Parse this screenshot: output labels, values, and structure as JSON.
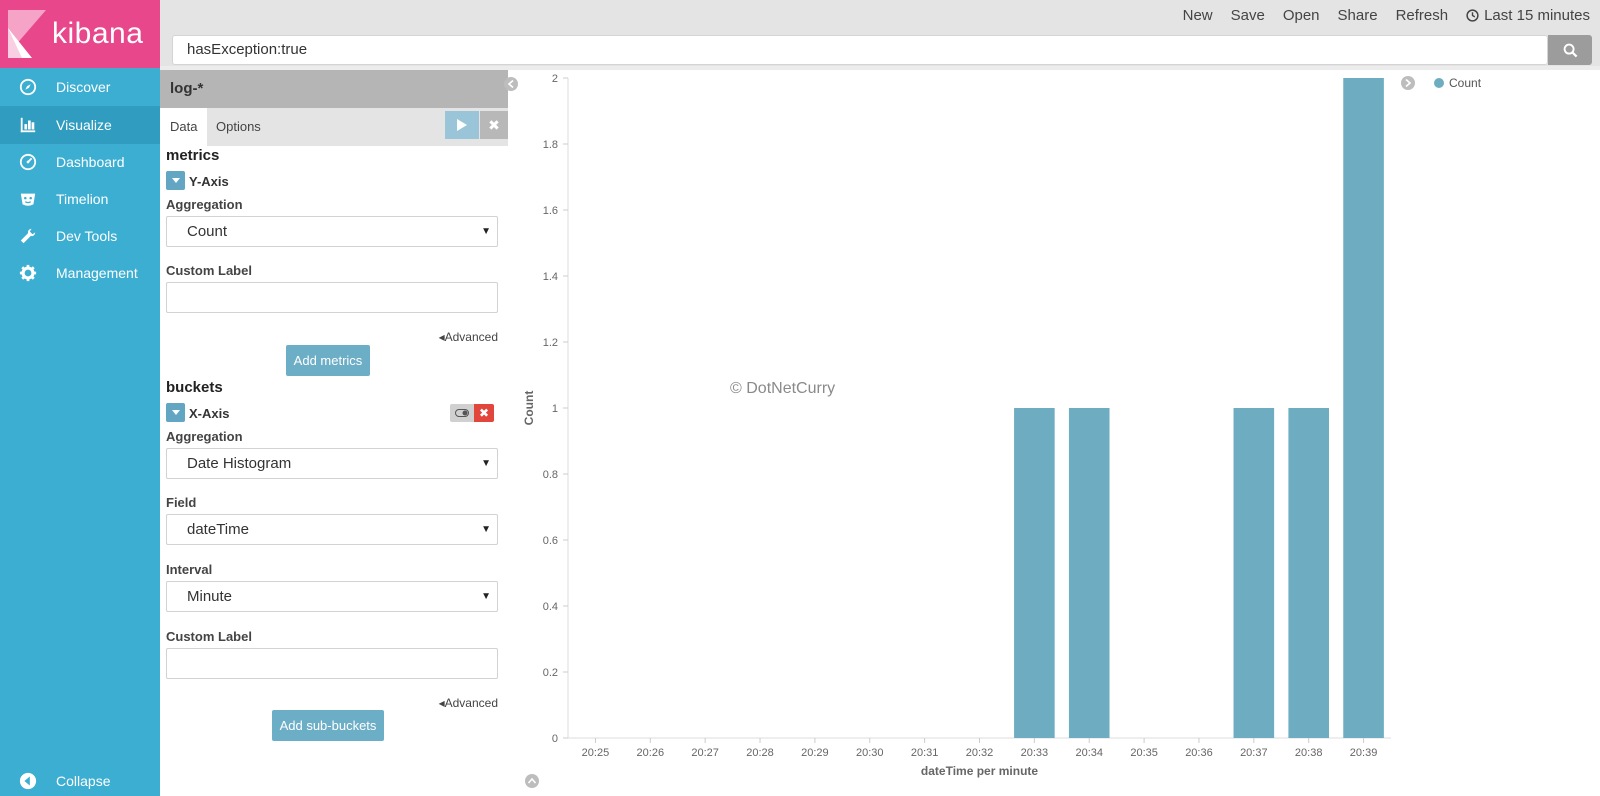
{
  "sidebar": {
    "logo_text": "kibana",
    "items": [
      {
        "label": "Discover",
        "icon": "compass-icon"
      },
      {
        "label": "Visualize",
        "icon": "bar-chart-icon"
      },
      {
        "label": "Dashboard",
        "icon": "dashboard-icon"
      },
      {
        "label": "Timelion",
        "icon": "timelion-icon"
      },
      {
        "label": "Dev Tools",
        "icon": "wrench-icon"
      },
      {
        "label": "Management",
        "icon": "gear-icon"
      }
    ],
    "active": "Visualize",
    "collapse_label": "Collapse"
  },
  "topbar": {
    "new": "New",
    "save": "Save",
    "open": "Open",
    "share": "Share",
    "refresh": "Refresh",
    "time_range": "Last 15 minutes"
  },
  "query": {
    "value": "hasException:true"
  },
  "editor": {
    "index_pattern": "log-*",
    "tabs": [
      "Data",
      "Options"
    ],
    "metrics_title": "metrics",
    "metric_agg_name": "Y-Axis",
    "aggregation_label": "Aggregation",
    "metric_aggregation": "Count",
    "custom_label": "Custom Label",
    "advanced": "Advanced",
    "add_metrics": "Add metrics",
    "buckets_title": "buckets",
    "bucket_agg_name": "X-Axis",
    "bucket_aggregation": "Date Histogram",
    "field_label": "Field",
    "field_value": "dateTime",
    "interval_label": "Interval",
    "interval_value": "Minute",
    "add_sub_buckets": "Add sub-buckets"
  },
  "watermark": "© DotNetCurry",
  "colors": {
    "bar": "#6eadc1",
    "sidebar": "#3caed2",
    "logo": "#e8488b"
  },
  "chart_data": {
    "type": "bar",
    "categories": [
      "20:25",
      "20:26",
      "20:27",
      "20:28",
      "20:29",
      "20:30",
      "20:31",
      "20:32",
      "20:33",
      "20:34",
      "20:35",
      "20:36",
      "20:37",
      "20:38",
      "20:39"
    ],
    "series": [
      {
        "name": "Count",
        "values": [
          0,
          0,
          0,
          0,
          0,
          0,
          0,
          0,
          1,
          1,
          0,
          0,
          1,
          1,
          2
        ]
      }
    ],
    "xlabel": "dateTime per minute",
    "ylabel": "Count",
    "ylim": [
      0,
      2
    ],
    "yticks": [
      0,
      0.2,
      0.4,
      0.6,
      0.8,
      1,
      1.2,
      1.4,
      1.6,
      1.8,
      2
    ],
    "legend": "top-right",
    "grid": false
  }
}
